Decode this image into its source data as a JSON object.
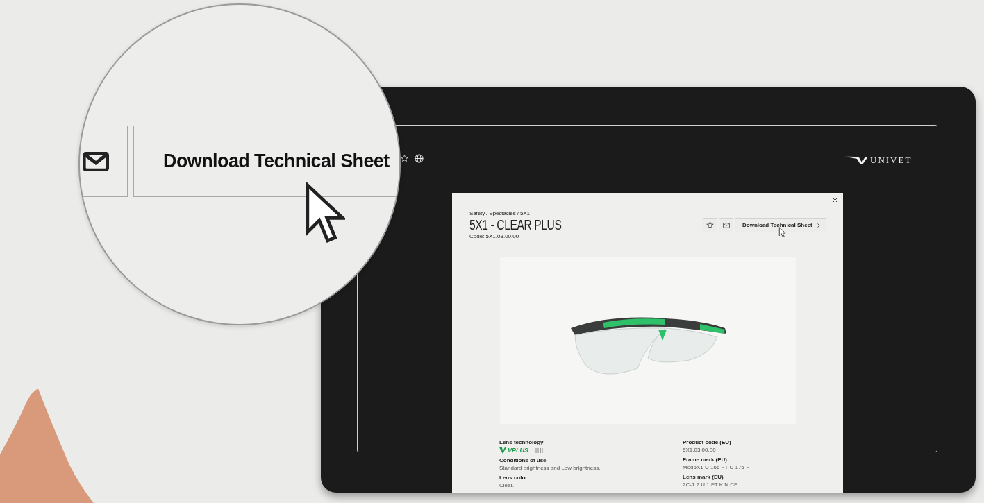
{
  "magnifier": {
    "download_label": "Download Technical Sheet"
  },
  "header": {
    "logo": "UNIVET"
  },
  "modal": {
    "breadcrumb": "Safety / Spectacles / 5X1",
    "title": "5X1 - CLEAR PLUS",
    "code": "Code: 5X1.03.00.00",
    "download_label": "Download Technical Sheet",
    "specs_left": [
      {
        "kind": "logo",
        "label": "Lens technology",
        "value": "VPLUS"
      },
      {
        "kind": "text",
        "label": "Conditions of use",
        "value": "Standard brightness and Low brightness."
      },
      {
        "kind": "text",
        "label": "Lens color",
        "value": "Clear."
      }
    ],
    "specs_right": [
      {
        "kind": "text",
        "label": "Product code (EU)",
        "value": "5X1.03.00.00"
      },
      {
        "kind": "text",
        "label": "Frame mark (EU)",
        "value": "Mod5X1 U 166 FT U 175-F"
      },
      {
        "kind": "text",
        "label": "Lens mark (EU)",
        "value": "2C-1.2 U 1 FT K N CE"
      }
    ]
  }
}
